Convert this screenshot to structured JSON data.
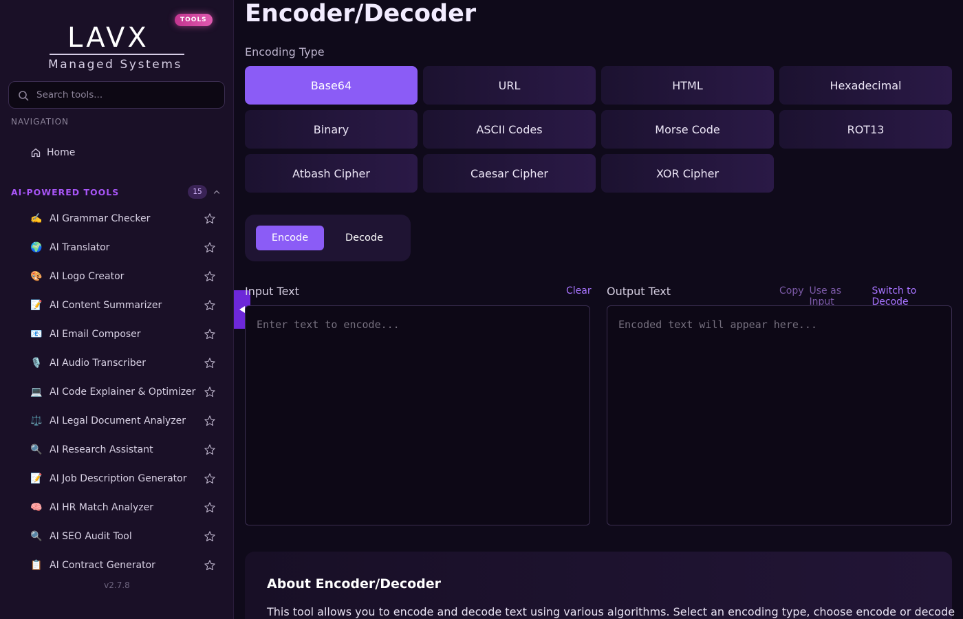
{
  "sidebar": {
    "logo_main": "LAVX",
    "logo_sub": "Managed Systems",
    "tools_badge": "TOOLS",
    "search_placeholder": "Search tools...",
    "nav_label": "NAVIGATION",
    "home_label": "Home",
    "ai_section_label": "AI-POWERED TOOLS",
    "ai_count": "15",
    "tools": [
      {
        "emoji": "✍️",
        "label": "AI Grammar Checker"
      },
      {
        "emoji": "🌍",
        "label": "AI Translator"
      },
      {
        "emoji": "🎨",
        "label": "AI Logo Creator"
      },
      {
        "emoji": "📝",
        "label": "AI Content Summarizer"
      },
      {
        "emoji": "📧",
        "label": "AI Email Composer"
      },
      {
        "emoji": "🎙️",
        "label": "AI Audio Transcriber"
      },
      {
        "emoji": "💻",
        "label": "AI Code Explainer & Optimizer"
      },
      {
        "emoji": "⚖️",
        "label": "AI Legal Document Analyzer"
      },
      {
        "emoji": "🔍",
        "label": "AI Research Assistant"
      },
      {
        "emoji": "📝",
        "label": "AI Job Description Generator"
      },
      {
        "emoji": "🧠",
        "label": "AI HR Match Analyzer"
      },
      {
        "emoji": "🔍",
        "label": "AI SEO Audit Tool"
      },
      {
        "emoji": "📋",
        "label": "AI Contract Generator"
      }
    ],
    "version": "v2.7.8"
  },
  "main": {
    "title": "Encoder/Decoder",
    "encoding_type_label": "Encoding Type",
    "encoding_types": [
      {
        "label": "Base64",
        "active": true
      },
      {
        "label": "URL"
      },
      {
        "label": "HTML"
      },
      {
        "label": "Hexadecimal"
      },
      {
        "label": "Binary"
      },
      {
        "label": "ASCII Codes"
      },
      {
        "label": "Morse Code"
      },
      {
        "label": "ROT13"
      },
      {
        "label": "Atbash Cipher"
      },
      {
        "label": "Caesar Cipher"
      },
      {
        "label": "XOR Cipher"
      }
    ],
    "mode": {
      "encode": "Encode",
      "decode": "Decode",
      "selected": "Encode"
    },
    "input": {
      "label": "Input Text",
      "clear": "Clear",
      "placeholder": "Enter text to encode...",
      "value": ""
    },
    "output": {
      "label": "Output Text",
      "copy": "Copy",
      "use_as_input": "Use as Input",
      "switch": "Switch to Decode",
      "placeholder": "Encoded text will appear here...",
      "value": ""
    },
    "about": {
      "title": "About Encoder/Decoder",
      "text": "This tool allows you to encode and decode text using various algorithms. Select an encoding type, choose encode or decode"
    }
  },
  "colors": {
    "accent": "#8b5cf6",
    "accent_text": "#a855f7",
    "background": "#0f0a1a",
    "sidebar": "#1a1027"
  }
}
